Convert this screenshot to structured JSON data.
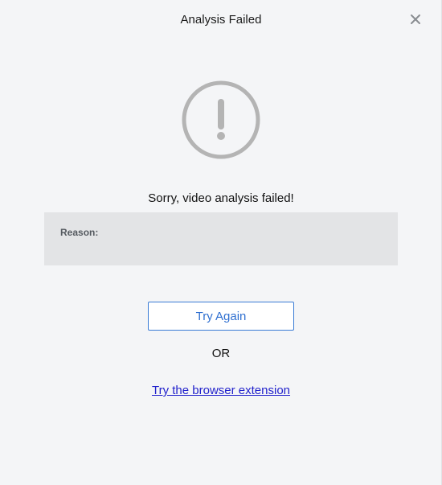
{
  "dialog": {
    "title": "Analysis Failed",
    "close_icon": "close-icon",
    "status_icon": "exclamation-circle-icon",
    "message": "Sorry, video analysis failed!",
    "reason": {
      "label": "Reason:",
      "value": ""
    },
    "try_again_label": "Try Again",
    "or_text": "OR",
    "extension_link_label": "Try the browser extension"
  },
  "colors": {
    "background": "#f4f5f7",
    "reason_box": "#e3e4e6",
    "button_border": "#3a7bd5",
    "button_text": "#2f6fd0",
    "icon_gray": "#b4b4b4",
    "link": "#2222cc"
  }
}
